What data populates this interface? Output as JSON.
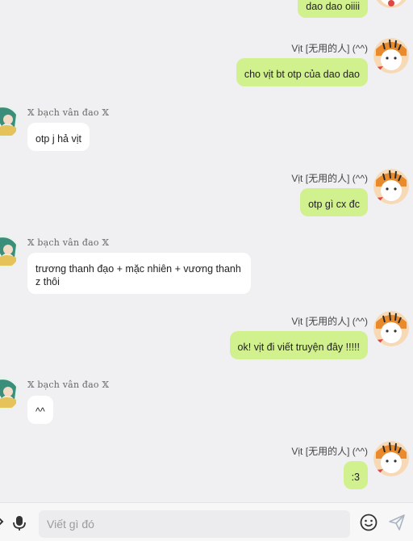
{
  "colors": {
    "outgoing_bubble": "#d1f08e",
    "incoming_bubble": "#ffffff",
    "background": "#f0f0f2"
  },
  "sender_right": "Vịt [无用的人] (^^)",
  "sender_left": "𝕏 bạch vân đao 𝕏",
  "messages": [
    {
      "side": "out",
      "text": "dao dao oiiii",
      "show_name": false
    },
    {
      "side": "out",
      "text": "cho vịt bt otp của dao dao",
      "show_name": true
    },
    {
      "side": "in",
      "text": "otp j hả vịt",
      "show_name": true
    },
    {
      "side": "out",
      "text": "otp gì cx đc",
      "show_name": true
    },
    {
      "side": "in",
      "text": "trương thanh đạo + mặc nhiên + vương thanh\nz thôi",
      "show_name": true
    },
    {
      "side": "out",
      "text": "ok! vịt đi viết truyện đây !!!!!",
      "show_name": true
    },
    {
      "side": "in",
      "text": "^^",
      "show_name": true
    },
    {
      "side": "out",
      "text": ":3",
      "show_name": true
    }
  ],
  "input": {
    "placeholder": "Viết gì đó",
    "value": ""
  },
  "icons": {
    "left_partial": "chevron-icon",
    "mic": "microphone-icon",
    "emoji": "emoji-icon",
    "send": "send-icon"
  }
}
